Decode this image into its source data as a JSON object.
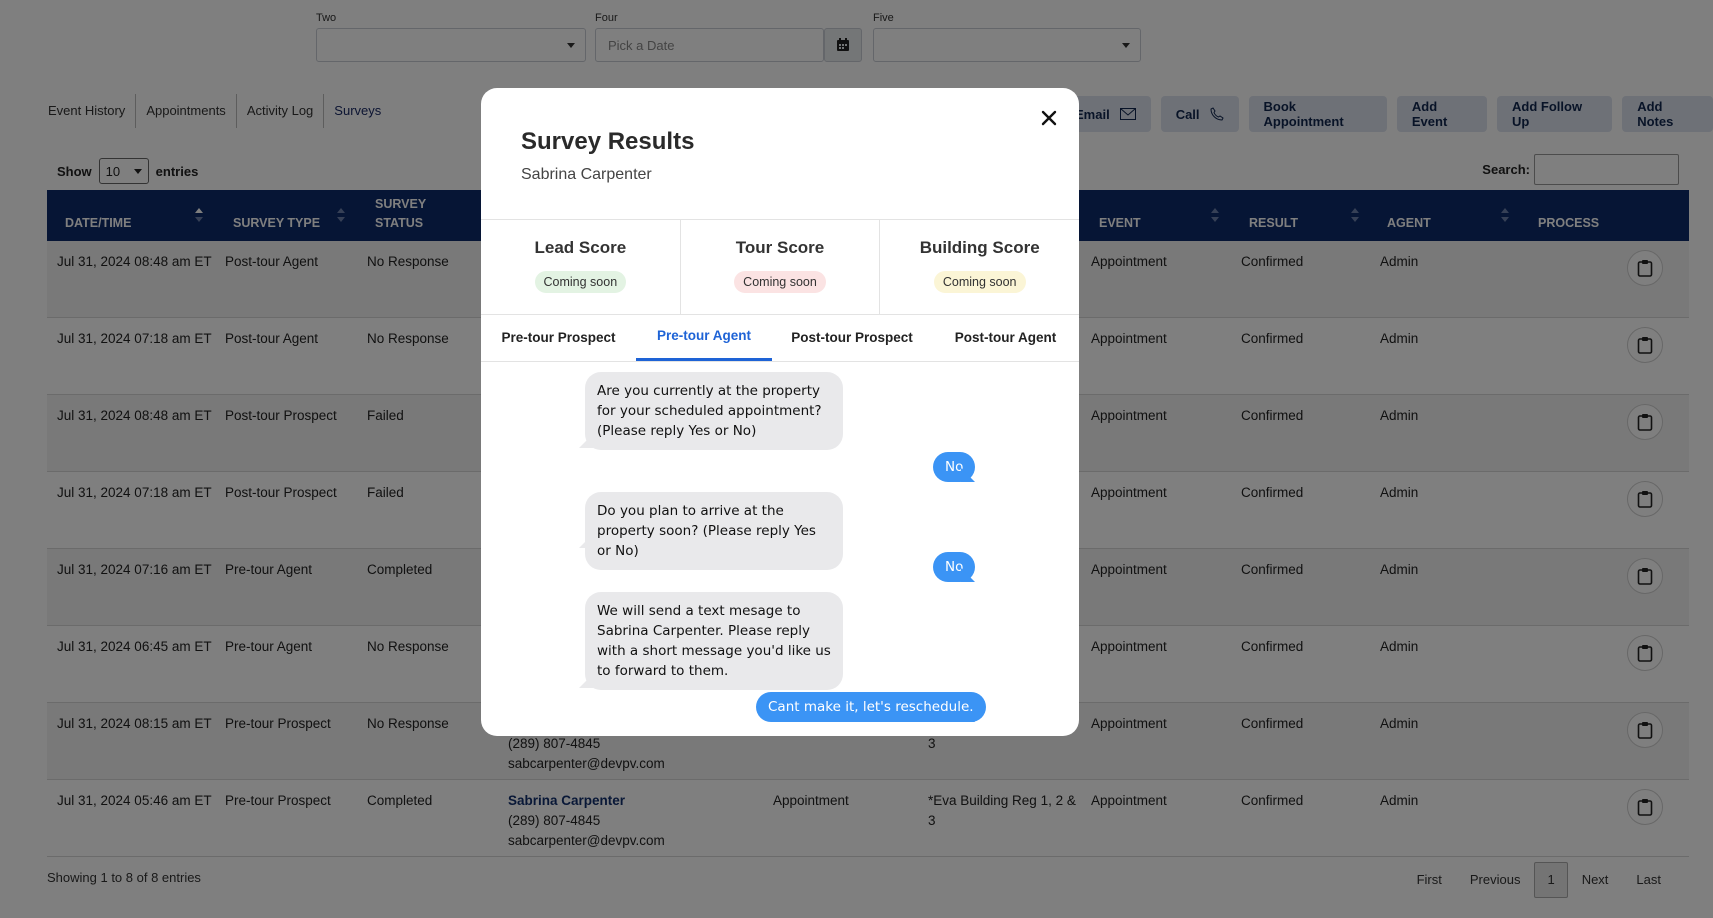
{
  "filters": [
    {
      "label": "Two",
      "placeholder": ""
    },
    {
      "label": "Four",
      "placeholder": "Pick a Date"
    },
    {
      "label": "Five",
      "placeholder": ""
    }
  ],
  "tabs": [
    "Event History",
    "Appointments",
    "Activity Log",
    "Surveys"
  ],
  "active_tab": "Surveys",
  "actions": {
    "email": "Email",
    "call": "Call",
    "book": "Book Appointment",
    "event": "Add Event",
    "followup": "Add Follow Up",
    "notes": "Add Notes"
  },
  "table": {
    "show_label": "Show",
    "entries_value": "10",
    "entries_label": "entries",
    "search_label": "Search:",
    "columns": [
      "DATE/TIME",
      "SURVEY TYPE",
      "SURVEY\nSTATUS",
      "EVENT",
      "RESULT",
      "AGENT",
      "PROCESS"
    ],
    "rows": [
      {
        "date": "Jul 31, 2024 08:48 am ET",
        "type": "Post-tour Agent",
        "status": "No Response",
        "event": "Appointment",
        "result": "Confirmed",
        "agent": "Admin"
      },
      {
        "date": "Jul 31, 2024 07:18 am ET",
        "type": "Post-tour Agent",
        "status": "No Response",
        "event": "Appointment",
        "result": "Confirmed",
        "agent": "Admin"
      },
      {
        "date": "Jul 31, 2024 08:48 am ET",
        "type": "Post-tour Prospect",
        "status": "Failed",
        "event": "Appointment",
        "result": "Confirmed",
        "agent": "Admin"
      },
      {
        "date": "Jul 31, 2024 07:18 am ET",
        "type": "Post-tour Prospect",
        "status": "Failed",
        "event": "Appointment",
        "result": "Confirmed",
        "agent": "Admin"
      },
      {
        "date": "Jul 31, 2024 07:16 am ET",
        "type": "Pre-tour Agent",
        "status": "Completed",
        "event": "Appointment",
        "result": "Confirmed",
        "agent": "Admin"
      },
      {
        "date": "Jul 31, 2024 06:45 am ET",
        "type": "Pre-tour Agent",
        "status": "No Response",
        "event": "Appointment",
        "result": "Confirmed",
        "agent": "Admin"
      },
      {
        "date": "Jul 31, 2024 08:15 am ET",
        "type": "Pre-tour Prospect",
        "status": "No Response",
        "phone": "(289) 807-4845",
        "email": "sabcarpenter@devpv.com",
        "building_tail": "3",
        "event": "Appointment",
        "result": "Confirmed",
        "agent": "Admin"
      },
      {
        "date": "Jul 31, 2024 05:46 am ET",
        "type": "Pre-tour Prospect",
        "status": "Completed",
        "lead": "Sabrina Carpenter",
        "phone": "(289) 807-4845",
        "email": "sabcarpenter@devpv.com",
        "lead_event": "Appointment",
        "building": "*Eva Building Reg 1, 2 &",
        "building_tail": "3",
        "event": "Appointment",
        "result": "Confirmed",
        "agent": "Admin"
      }
    ],
    "info": "Showing 1 to 8 of 8 entries",
    "pager": {
      "first": "First",
      "previous": "Previous",
      "current": "1",
      "next": "Next",
      "last": "Last"
    }
  },
  "modal": {
    "title": "Survey Results",
    "subtitle": "Sabrina Carpenter",
    "scores": [
      {
        "label": "Lead Score",
        "status": "Coming soon",
        "color": "#e3f3e3"
      },
      {
        "label": "Tour Score",
        "status": "Coming soon",
        "color": "#fbe3e3"
      },
      {
        "label": "Building Score",
        "status": "Coming soon",
        "color": "#fbf5d6"
      }
    ],
    "tabs": [
      "Pre-tour Prospect",
      "Pre-tour Agent",
      "Post-tour Prospect",
      "Post-tour Agent"
    ],
    "active_tab": "Pre-tour Agent",
    "messages": [
      {
        "from": "system",
        "text": "Are you currently at the property for your scheduled appointment? (Please reply Yes or No)"
      },
      {
        "from": "user",
        "text": "No"
      },
      {
        "from": "system",
        "text": "Do you plan to arrive at the property soon? (Please reply Yes or No)"
      },
      {
        "from": "user",
        "text": "No"
      },
      {
        "from": "system",
        "text": "We will send a text mesage to Sabrina Carpenter. Please reply with a short message you'd like us to forward to them."
      },
      {
        "from": "user",
        "text": "Cant make it, let's reschedule."
      }
    ]
  },
  "colors": {
    "header": "#0d2a6b",
    "accent": "#1e63d6",
    "bubble_out": "#3b94f5",
    "bubble_in": "#e9e9eb"
  }
}
